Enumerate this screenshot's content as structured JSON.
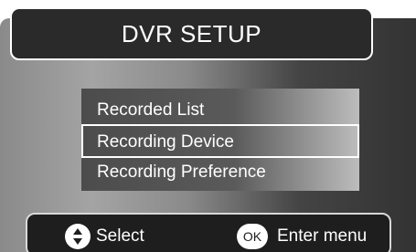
{
  "header": {
    "title": "DVR SETUP"
  },
  "menu": {
    "items": [
      {
        "label": "Recorded List",
        "selected": false
      },
      {
        "label": "Recording Device",
        "selected": true
      },
      {
        "label": "Recording Preference",
        "selected": false
      }
    ]
  },
  "footer": {
    "select_icon": "up-down-arrows-icon",
    "select_label": "Select",
    "ok_icon_text": "OK",
    "enter_label": "Enter menu"
  },
  "colors": {
    "title_bar": "#2a2a2a",
    "bottom_bar": "#1e1e1e",
    "text": "#ffffff",
    "selection_border": "#ffffff"
  }
}
